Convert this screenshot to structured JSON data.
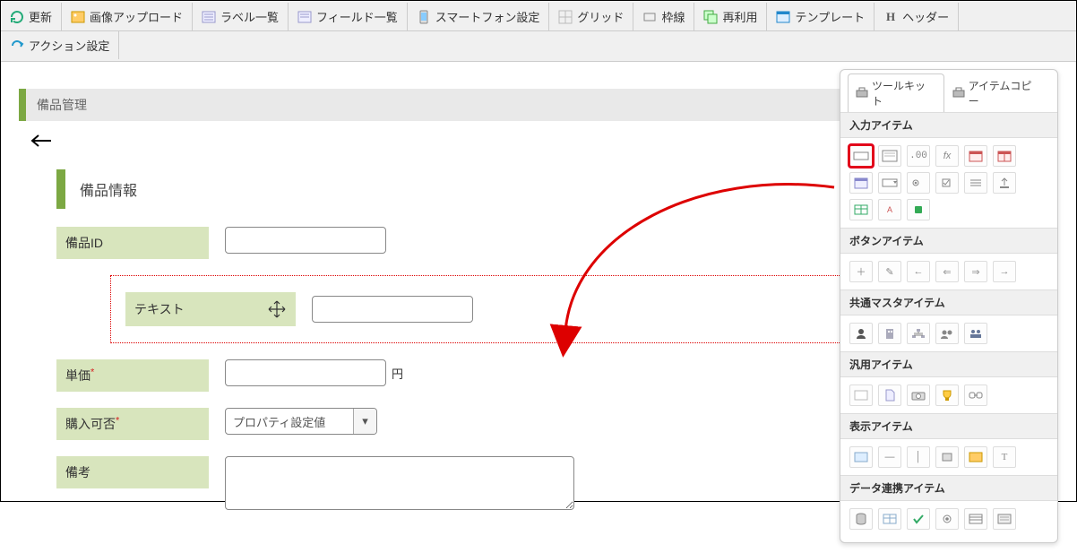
{
  "toolbar": {
    "update": "更新",
    "image_upload": "画像アップロード",
    "label_list": "ラベル一覧",
    "field_list": "フィールド一覧",
    "smartphone": "スマートフォン設定",
    "grid": "グリッド",
    "border": "枠線",
    "reuse": "再利用",
    "template": "テンプレート",
    "header": "ヘッダー",
    "action": "アクション設定"
  },
  "page": {
    "title": "備品管理",
    "section_title": "備品情報"
  },
  "form": {
    "id_label": "備品ID",
    "text_label": "テキスト",
    "price_label": "単価",
    "price_unit": "円",
    "purchasable_label": "購入可否",
    "purchasable_value": "プロパティ設定値",
    "remarks_label": "備考"
  },
  "toolpanel": {
    "tab_toolkit": "ツールキット",
    "tab_itemcopy": "アイテムコピー",
    "section_input": "入力アイテム",
    "section_button": "ボタンアイテム",
    "section_master": "共通マスタアイテム",
    "section_general": "汎用アイテム",
    "section_display": "表示アイテム",
    "section_data": "データ連携アイテム"
  }
}
